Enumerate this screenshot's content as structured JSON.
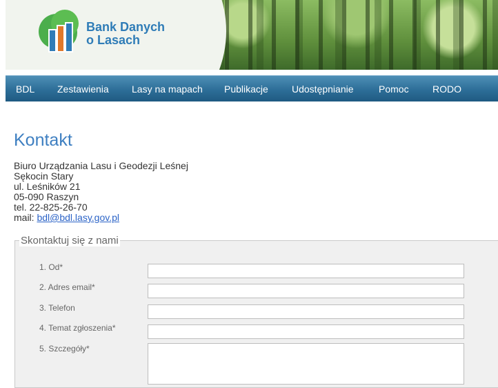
{
  "header": {
    "logo_line1": "Bank Danych",
    "logo_line2": "o Lasach"
  },
  "nav": {
    "items": [
      "BDL",
      "Zestawienia",
      "Lasy na mapach",
      "Publikacje",
      "Udostępnianie",
      "Pomoc",
      "RODO"
    ]
  },
  "page": {
    "title": "Kontakt",
    "address": {
      "line1": "Biuro Urządzania Lasu i Geodezji Leśnej",
      "line2": "Sękocin Stary",
      "line3": "ul. Leśników 21",
      "line4": "05-090 Raszyn",
      "phone": "tel. 22-825-26-70",
      "mail_label": "mail: ",
      "mail_link": "bdl@bdl.lasy.gov.pl"
    }
  },
  "form": {
    "legend": "Skontaktuj się z nami",
    "fields": [
      {
        "label": "1. Od*"
      },
      {
        "label": "2. Adres email*"
      },
      {
        "label": "3. Telefon"
      },
      {
        "label": "4. Temat zgłoszenia*"
      },
      {
        "label": "5. Szczegóły*"
      }
    ]
  },
  "colors": {
    "nav": "#2d6e98",
    "title": "#3e7fc1",
    "logo_text": "#2f7cb7",
    "link": "#2b63c7"
  }
}
